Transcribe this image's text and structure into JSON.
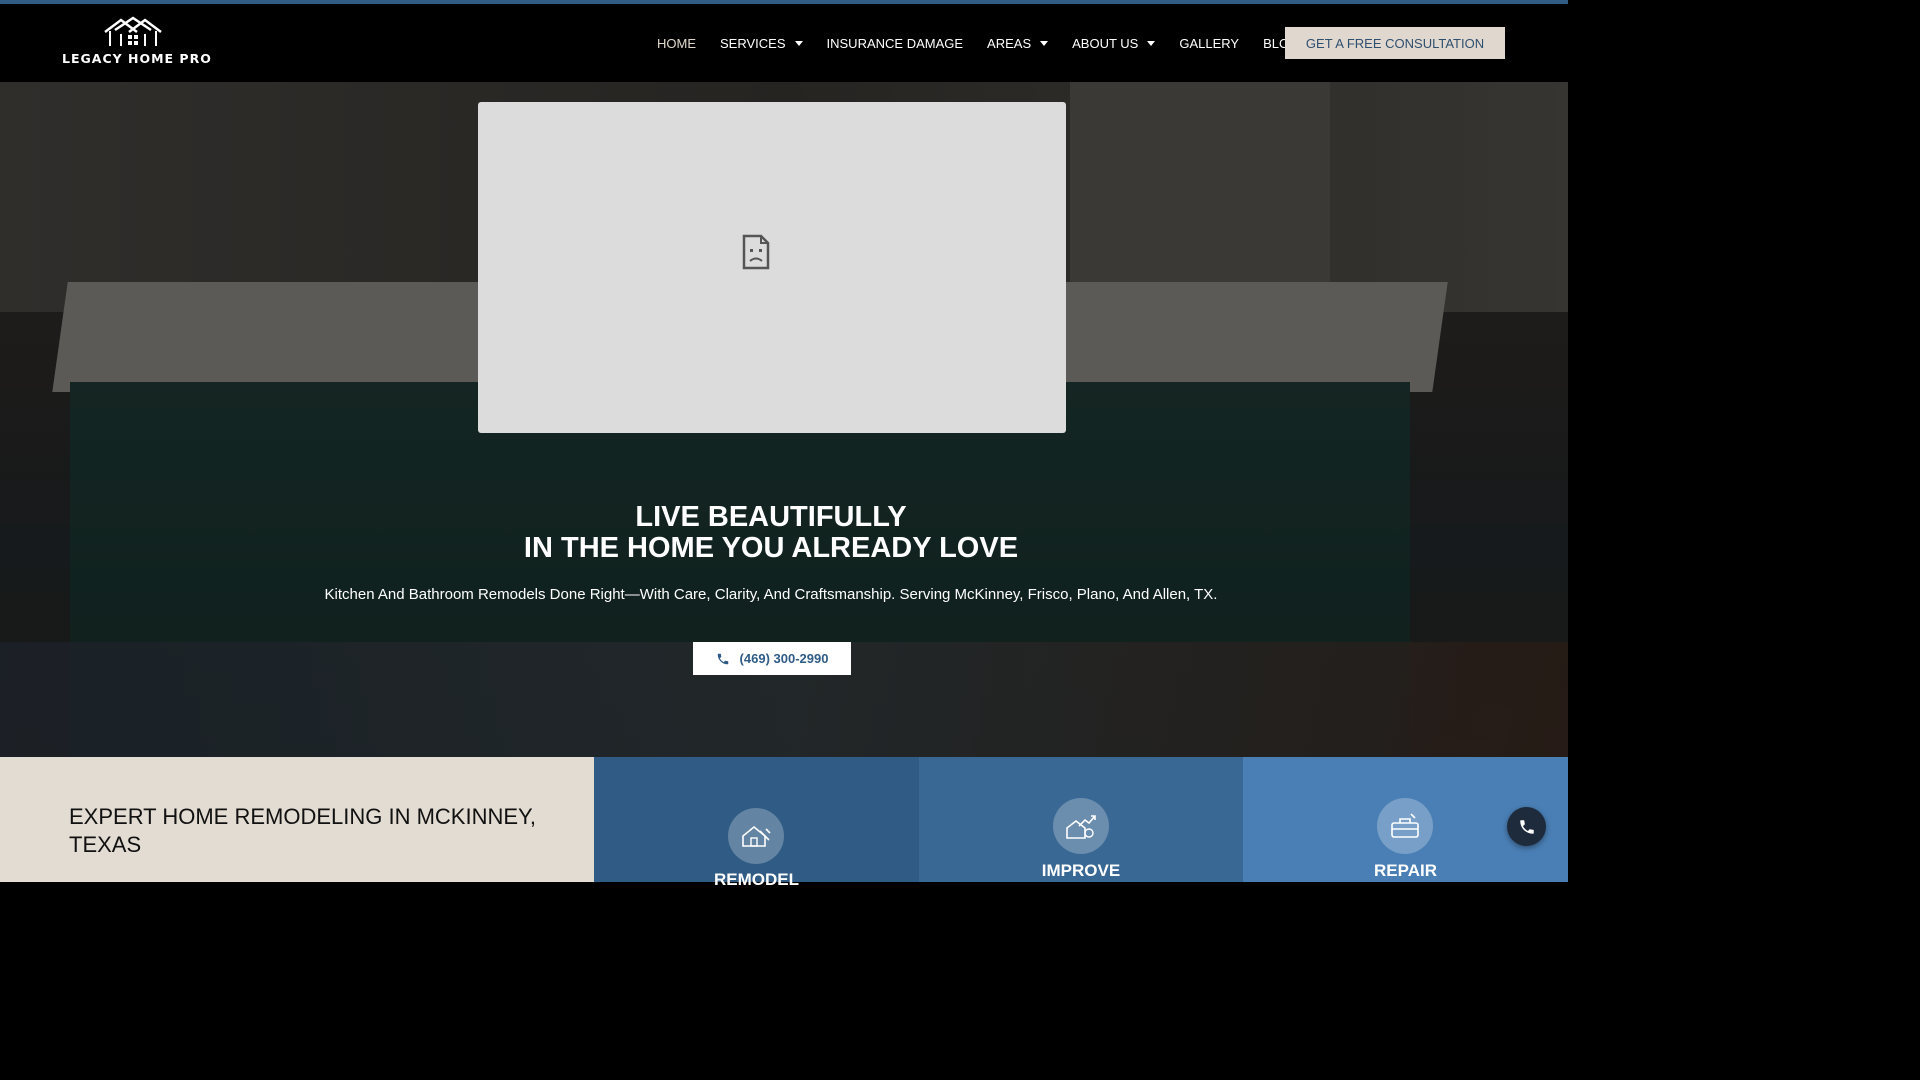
{
  "brand": {
    "name": "LEGACY HOME PRO"
  },
  "nav": {
    "items": [
      {
        "label": "HOME",
        "dropdown": false,
        "active": true
      },
      {
        "label": "SERVICES",
        "dropdown": true
      },
      {
        "label": "INSURANCE DAMAGE",
        "dropdown": false
      },
      {
        "label": "AREAS",
        "dropdown": true
      },
      {
        "label": "ABOUT US",
        "dropdown": true
      },
      {
        "label": "GALLERY",
        "dropdown": false
      },
      {
        "label": "BLOG",
        "dropdown": false
      }
    ],
    "cta_label": "GET A FREE CONSULTATION"
  },
  "hero": {
    "video_icon": "broken-document-icon",
    "title_line1": "LIVE BEAUTIFULLY",
    "title_line2": "IN THE HOME YOU ALREADY LOVE",
    "subtitle": "Kitchen And Bathroom Remodels Done Right—With Care, Clarity, And Craftsmanship. Serving McKinney, Frisco, Plano, And Allen, TX.",
    "phone_label": "(469) 300-2990",
    "phone_icon": "phone-icon"
  },
  "expert": {
    "heading": "EXPERT HOME REMODELING IN MCKINNEY, TEXAS"
  },
  "services": [
    {
      "label": "REMODEL",
      "icon": "house-tools-icon"
    },
    {
      "label": "IMPROVE",
      "icon": "house-growth-icon"
    },
    {
      "label": "REPAIR",
      "icon": "toolbox-icon"
    }
  ],
  "colors": {
    "accent": "#2f5b85",
    "cta_bg": "#e0d8cf",
    "expert_bg": "#e3dcd3"
  }
}
